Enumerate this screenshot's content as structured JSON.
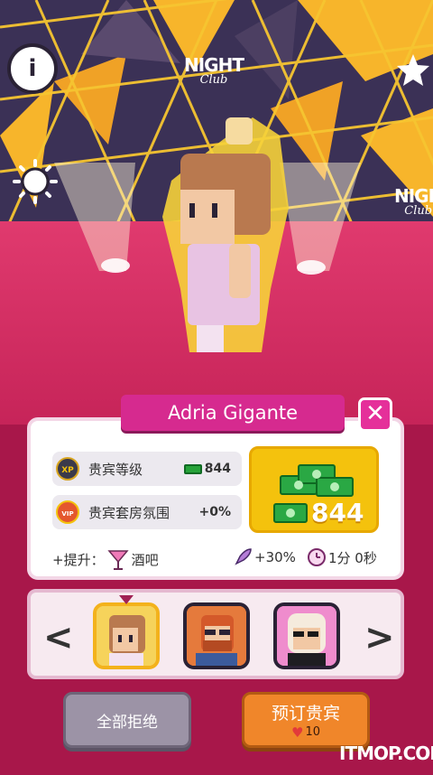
{
  "top_bar": {
    "logo_primary": "NIGHT",
    "logo_secondary": "Club",
    "logo_right_primary": "NIGH",
    "logo_right_secondary": "Club"
  },
  "vip": {
    "name": "Adria Gigante",
    "stats": [
      {
        "icon": "xp-badge-icon",
        "badge_text": "XP",
        "label": "贵宾等级",
        "value": "844",
        "value_icon": "cash-icon"
      },
      {
        "icon": "vip-badge-icon",
        "badge_text": "VIP",
        "label": "贵宾套房氛围",
        "value": "+0%"
      }
    ],
    "reward_amount": "844",
    "boost": {
      "prefix": "+提升：",
      "venue": "酒吧",
      "speed_bonus": "+30%",
      "duration": "1分 0秒"
    }
  },
  "carousel": {
    "prev": "<",
    "next": ">",
    "selected_index": 0,
    "guests": [
      "guest-woman-brown-hair",
      "guest-man-red-beard",
      "guest-woman-blonde-sunglasses"
    ]
  },
  "buttons": {
    "reject_all": "全部拒绝",
    "book_vip": "预订贵宾",
    "book_cost": "10"
  },
  "watermark": "ITMOP.COM",
  "colors": {
    "accent_pink": "#d62a8f",
    "book_orange": "#f0862a",
    "reject_gray": "#9c93a6",
    "reward_yellow": "#f4c20d"
  }
}
